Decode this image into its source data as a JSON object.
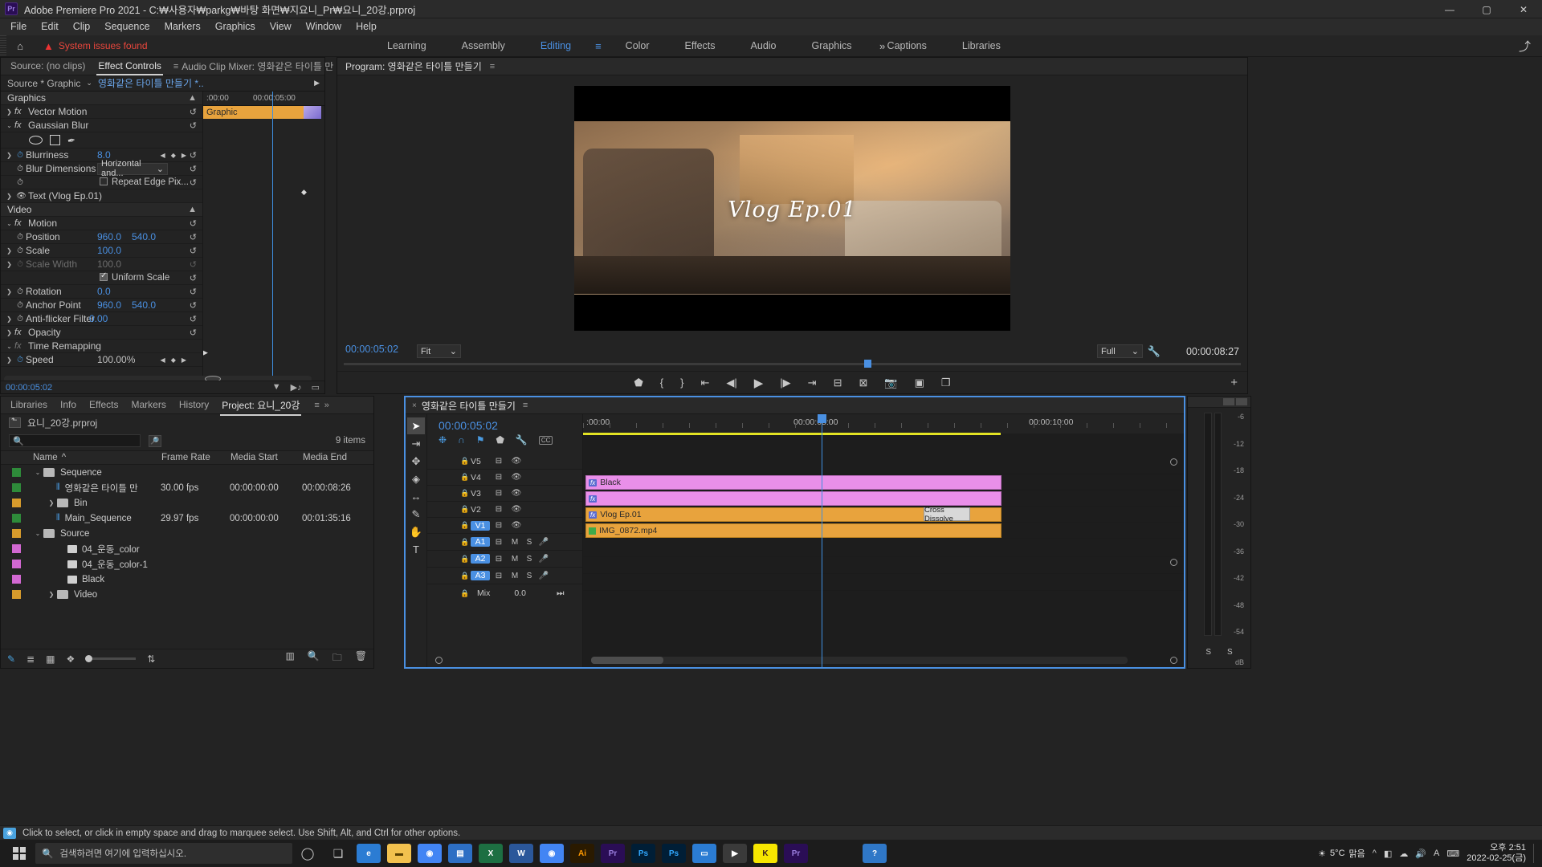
{
  "window": {
    "app_icon": "Pr",
    "title": "Adobe Premiere Pro 2021 - C:₩사용자₩parkg₩바탕 화면₩지요니_Pr₩요니_20강.prproj",
    "minimize": "—",
    "maximize": "▢",
    "close": "✕"
  },
  "menubar": {
    "items": [
      "File",
      "Edit",
      "Clip",
      "Sequence",
      "Markers",
      "Graphics",
      "View",
      "Window",
      "Help"
    ]
  },
  "workspace": {
    "home_icon": "home-icon",
    "system_issue": "System issues found",
    "tabs": [
      {
        "label": "Learning",
        "active": false
      },
      {
        "label": "Assembly",
        "active": false
      },
      {
        "label": "Editing",
        "active": true
      },
      {
        "label": "Color",
        "active": false
      },
      {
        "label": "Effects",
        "active": false
      },
      {
        "label": "Audio",
        "active": false
      },
      {
        "label": "Graphics",
        "active": false
      },
      {
        "label": "Captions",
        "active": false
      },
      {
        "label": "Libraries",
        "active": false
      }
    ],
    "more": "»",
    "export_icon": "export-icon"
  },
  "effect_controls": {
    "tabs": [
      {
        "label": "Source: (no clips)",
        "active": false
      },
      {
        "label": "Effect Controls",
        "active": true
      },
      {
        "label": "Audio Clip Mixer: 영화같은 타이틀 만",
        "active": false
      }
    ],
    "more_tabs": "»",
    "source_label": "Source * Graphic",
    "source_clip": "영화같은 타이틀 만들기 *..",
    "ruler": {
      "t0": ":00:00",
      "t1": "00:00:05:00"
    },
    "clip_bar_label": "Graphic",
    "sections": [
      {
        "name": "Graphics",
        "type": "group"
      },
      {
        "name": "Vector Motion",
        "type": "fx",
        "expanded": false
      },
      {
        "name": "Gaussian Blur",
        "type": "fx",
        "expanded": true
      },
      {
        "name": "Blurriness",
        "value": "8.0",
        "type": "prop",
        "stopwatch": true
      },
      {
        "name": "Blur Dimensions",
        "value": "Horizontal and...",
        "type": "dropdown"
      },
      {
        "name": "Repeat Edge Pix...",
        "type": "checkbox",
        "checked": false
      },
      {
        "name": "Text (Vlog Ep.01)",
        "type": "text-layer"
      },
      {
        "name": "Video",
        "type": "group"
      },
      {
        "name": "Motion",
        "type": "fx",
        "expanded": true
      },
      {
        "name": "Position",
        "value": "960.0",
        "value2": "540.0",
        "type": "prop"
      },
      {
        "name": "Scale",
        "value": "100.0",
        "type": "prop"
      },
      {
        "name": "Scale Width",
        "value": "100.0",
        "type": "prop",
        "disabled": true
      },
      {
        "name": "Uniform Scale",
        "type": "checkbox",
        "checked": true
      },
      {
        "name": "Rotation",
        "value": "0.0",
        "type": "prop"
      },
      {
        "name": "Anchor Point",
        "value": "960.0",
        "value2": "540.0",
        "type": "prop"
      },
      {
        "name": "Anti-flicker Filter",
        "value": "0.00",
        "type": "prop"
      },
      {
        "name": "Opacity",
        "type": "fx",
        "expanded": false
      },
      {
        "name": "Time Remapping",
        "type": "fx",
        "expanded": true
      },
      {
        "name": "Speed",
        "value": "100.00%",
        "type": "prop",
        "stopwatch": true
      }
    ],
    "footer_timecode": "00:00:05:02"
  },
  "program_monitor": {
    "title": "Program: 영화같은 타이틀 만들기",
    "overlay_text": "Vlog Ep.01",
    "timecode_left": "00:00:05:02",
    "fit_label": "Fit",
    "resolution_label": "Full",
    "timecode_right": "00:00:08:27",
    "transport_icons": [
      "add-marker-icon",
      "mark-in-icon",
      "mark-out-icon",
      "go-to-in-icon",
      "step-back-icon",
      "play-icon",
      "step-forward-icon",
      "go-to-out-icon",
      "lift-icon",
      "extract-icon",
      "export-frame-icon",
      "safe-margins-icon",
      "comparison-view-icon"
    ],
    "plus_icon": "button-editor-icon"
  },
  "project_panel": {
    "tabs": [
      {
        "label": "Libraries",
        "active": false
      },
      {
        "label": "Info",
        "active": false
      },
      {
        "label": "Effects",
        "active": false
      },
      {
        "label": "Markers",
        "active": false
      },
      {
        "label": "History",
        "active": false
      },
      {
        "label": "Project: 요니_20강",
        "active": true
      }
    ],
    "more_tabs": "»",
    "project_file": "요니_20강.prproj",
    "search_placeholder": "",
    "item_count": "9 items",
    "columns": [
      "Name",
      "Frame Rate",
      "Media Start",
      "Media End"
    ],
    "rows": [
      {
        "swatch": "#2e8b3a",
        "indent": 1,
        "twirl": "v",
        "icon": "folder",
        "name": "Sequence",
        "frame_rate": "",
        "media_start": "",
        "media_end": ""
      },
      {
        "swatch": "#2e8b3a",
        "indent": 2,
        "twirl": "",
        "icon": "sequence",
        "name": "영화같은 타이틀 만",
        "frame_rate": "30.00 fps",
        "media_start": "00:00:00:00",
        "media_end": "00:00:08:26"
      },
      {
        "swatch": "#d79b2c",
        "indent": 2,
        "twirl": ">",
        "icon": "folder",
        "name": "Bin",
        "frame_rate": "",
        "media_start": "",
        "media_end": ""
      },
      {
        "swatch": "#2e8b3a",
        "indent": 3,
        "twirl": "",
        "icon": "sequence",
        "name": "Main_Sequence",
        "frame_rate": "29.97 fps",
        "media_start": "00:00:00:00",
        "media_end": "00:01:35:16"
      },
      {
        "swatch": "#d79b2c",
        "indent": 1,
        "twirl": "v",
        "icon": "folder",
        "name": "Source",
        "frame_rate": "",
        "media_start": "",
        "media_end": ""
      },
      {
        "swatch": "#d268d2",
        "indent": 3,
        "twirl": "",
        "icon": "clip",
        "name": "04_운동_color",
        "frame_rate": "",
        "media_start": "",
        "media_end": ""
      },
      {
        "swatch": "#d268d2",
        "indent": 3,
        "twirl": "",
        "icon": "clip",
        "name": "04_운동_color-1",
        "frame_rate": "",
        "media_start": "",
        "media_end": ""
      },
      {
        "swatch": "#d268d2",
        "indent": 3,
        "twirl": "",
        "icon": "clip",
        "name": "Black",
        "frame_rate": "",
        "media_start": "",
        "media_end": ""
      },
      {
        "swatch": "#d79b2c",
        "indent": 1,
        "twirl": ">",
        "icon": "folder",
        "name": "Video",
        "frame_rate": "",
        "media_start": "",
        "media_end": ""
      }
    ],
    "footer_icons": [
      "new-item-icon",
      "list-view-icon",
      "icon-view-icon",
      "freeform-view-icon",
      "zoom-slider",
      "sort-icon",
      "auto-match-icon",
      "find-icon",
      "new-bin-icon",
      "delete-icon"
    ]
  },
  "timeline": {
    "close_icon": "×",
    "title": "영화같은 타이틀 만들기",
    "timecode": "00:00:05:02",
    "ruler_labels": [
      ":00:00",
      "00:00:05:00",
      "00:00:10:00"
    ],
    "tools": [
      {
        "name": "selection-tool",
        "glyph": "➤",
        "active": true
      },
      {
        "name": "track-select-forward-tool",
        "glyph": "⇥",
        "active": false
      },
      {
        "name": "ripple-edit-tool",
        "glyph": "↔",
        "active": false
      },
      {
        "name": "rolling-edit-tool",
        "glyph": "◈",
        "active": false
      },
      {
        "name": "rate-stretch-tool",
        "glyph": "|↔|",
        "active": false
      },
      {
        "name": "razor-tool",
        "glyph": "✂",
        "active": false
      },
      {
        "name": "slip-tool",
        "glyph": "✋",
        "active": false
      },
      {
        "name": "type-tool",
        "glyph": "T",
        "active": false
      }
    ],
    "sequence_tools": [
      "nest-icon",
      "snap-icon",
      "linked-selection-icon",
      "add-marker-icon",
      "settings-wrench-icon",
      "cc-icon"
    ],
    "tracks": [
      {
        "name": "V5",
        "type": "video",
        "selected": false,
        "clips": []
      },
      {
        "name": "V4",
        "type": "video",
        "selected": false,
        "clips": [
          {
            "label": "Black",
            "color": "pink",
            "fx": true,
            "start_pct": 0,
            "width_pct": 100
          }
        ]
      },
      {
        "name": "V3",
        "type": "video",
        "selected": false,
        "clips": [
          {
            "label": "",
            "color": "pink",
            "fx": false,
            "start_pct": 0,
            "width_pct": 100
          }
        ]
      },
      {
        "name": "V2",
        "type": "video",
        "selected": false,
        "clips": [
          {
            "label": "Vlog Ep.01",
            "color": "orange",
            "fx": true,
            "start_pct": 0,
            "width_pct": 100
          }
        ]
      },
      {
        "name": "V1",
        "type": "video",
        "selected": true,
        "clips": [
          {
            "label": "IMG_0872.mp4",
            "color": "orange",
            "fx": false,
            "start_pct": 0,
            "width_pct": 100
          }
        ]
      },
      {
        "name": "A1",
        "type": "audio",
        "selected": true,
        "clips": []
      },
      {
        "name": "A2",
        "type": "audio",
        "selected": true,
        "clips": []
      },
      {
        "name": "A3",
        "type": "audio",
        "selected": true,
        "clips": []
      }
    ],
    "transition_label": "Cross Dissolve",
    "mix_label": "Mix",
    "mix_value": "0.0"
  },
  "audio_meter": {
    "scale": [
      "-6",
      "-12",
      "-18",
      "-24",
      "-30",
      "-36",
      "-42",
      "-48",
      "-54"
    ],
    "solo_left": "S",
    "solo_right": "S",
    "db_label": "dB"
  },
  "status_bar": {
    "text": "Click to select, or click in empty space and drag to marquee select. Use Shift, Alt, and Ctrl for other options."
  },
  "taskbar": {
    "search_placeholder": "검색하려면 여기에 입력하십시오.",
    "apps": [
      {
        "name": "cortana-icon",
        "label": "◯",
        "color": "transparent"
      },
      {
        "name": "task-view-icon",
        "label": "❏",
        "color": "transparent"
      },
      {
        "name": "edge-icon",
        "label": "e",
        "color": "#2b7cd3"
      },
      {
        "name": "explorer-icon",
        "label": "📁",
        "color": "#f2c14e"
      },
      {
        "name": "chrome-icon",
        "label": "◉",
        "color": "#4285f4"
      },
      {
        "name": "store-icon",
        "label": "▤",
        "color": "#2d6fc4"
      },
      {
        "name": "excel-icon",
        "label": "X",
        "color": "#1d6f42"
      },
      {
        "name": "word-icon",
        "label": "W",
        "color": "#2b579a"
      },
      {
        "name": "chrome2-icon",
        "label": "◉",
        "color": "#4285f4"
      },
      {
        "name": "illustrator-icon",
        "label": "Ai",
        "color": "#2a1a00"
      },
      {
        "name": "premiere-icon",
        "label": "Pr",
        "color": "#2a0d55"
      },
      {
        "name": "photoshop-icon",
        "label": "Ps",
        "color": "#001e36"
      },
      {
        "name": "photoshop2-icon",
        "label": "Ps",
        "color": "#001e36"
      },
      {
        "name": "folder2-icon",
        "label": "▭",
        "color": "#2b7cd3"
      },
      {
        "name": "media-icon",
        "label": "▶",
        "color": "#3a3a3a"
      },
      {
        "name": "kakao-icon",
        "label": "K",
        "color": "#f7e600"
      },
      {
        "name": "premiere2-icon",
        "label": "Pr",
        "color": "#2a0d55"
      }
    ],
    "help_icon": "?",
    "weather_temp": "5°C",
    "weather_desc": "맑음",
    "tray_icons": [
      "^",
      "◧",
      "☁",
      "🔊",
      "A",
      "⌨"
    ],
    "time": "오후 2:51",
    "date": "2022-02-25(금)"
  }
}
